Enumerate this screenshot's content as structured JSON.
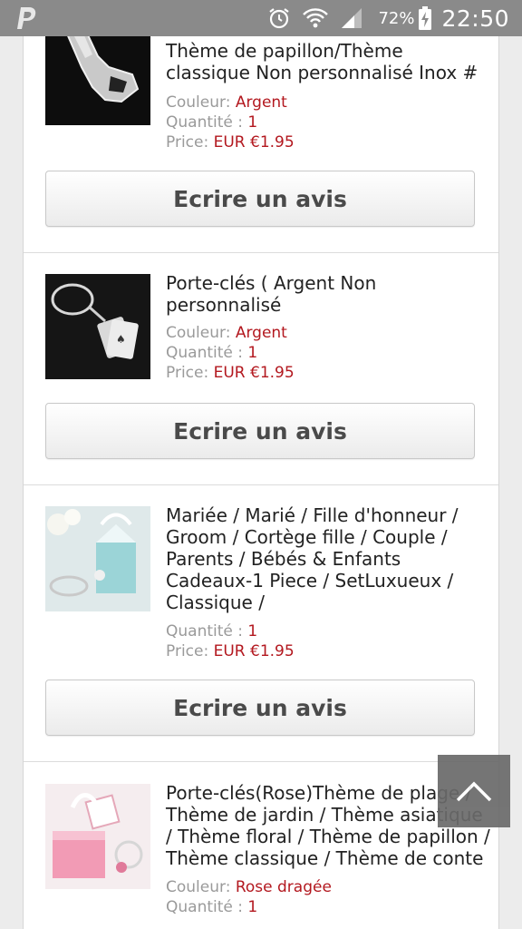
{
  "status_bar": {
    "battery_percent": "72%",
    "time": "22:50",
    "icons": [
      "paypal-icon",
      "alarm-icon",
      "wifi-icon",
      "signal-icon",
      "battery-charging-icon"
    ]
  },
  "items": [
    {
      "title": "Thème de papillon/Thème classique Non personnalisé Inox #",
      "color_label": "Couleur:",
      "color_value": "Argent",
      "qty_label": "Quantité :",
      "qty_value": "1",
      "price_label": "Price:",
      "price_value": "EUR €1.95",
      "button_label": "Ecrire un avis"
    },
    {
      "title": "Porte-clés ( Argent Non personnalisé",
      "color_label": "Couleur:",
      "color_value": "Argent",
      "qty_label": "Quantité :",
      "qty_value": "1",
      "price_label": "Price:",
      "price_value": "EUR €1.95",
      "button_label": "Ecrire un avis"
    },
    {
      "title": "Mariée / Marié / Fille d'honneur / Groom / Cortège fille / Couple / Parents / Bébés & Enfants Cadeaux-1 Piece / SetLuxueux / Classique /",
      "qty_label": "Quantité :",
      "qty_value": "1",
      "price_label": "Price:",
      "price_value": "EUR €1.95",
      "button_label": "Ecrire un avis"
    },
    {
      "title": "Porte-clés(Rose)Thème de plage / Thème de jardin / Thème asiatique / Thème floral / Thème de papillon / Thème classique / Thème de conte",
      "color_label": "Couleur:",
      "color_value": "Rose dragée",
      "qty_label": "Quantité :",
      "qty_value": "1"
    }
  ],
  "colors": {
    "value_red": "#b3181f",
    "label_gray": "#9a9a9a",
    "status_bar": "#8a8a8a"
  }
}
